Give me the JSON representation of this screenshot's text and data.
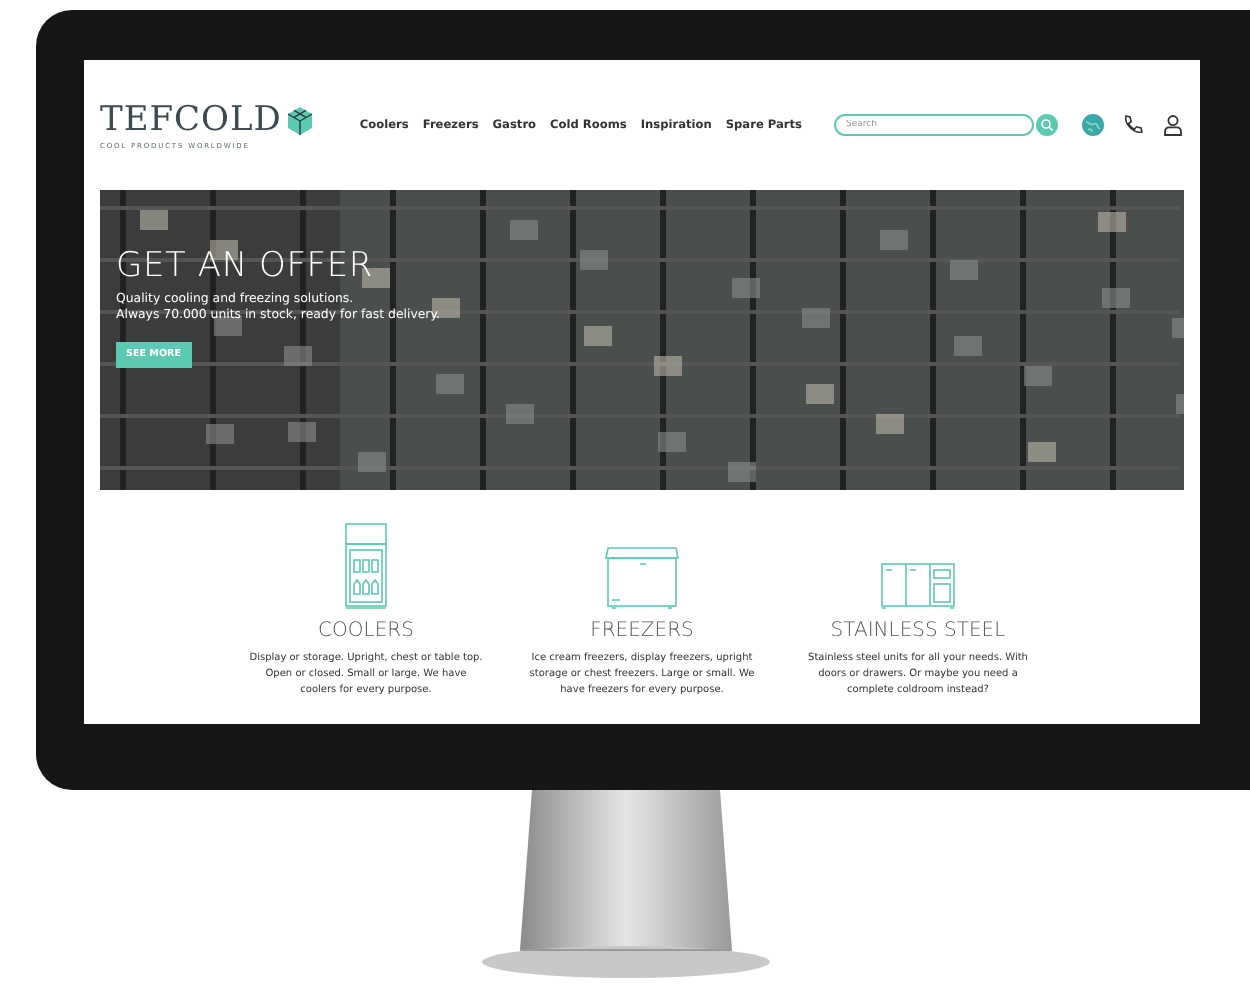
{
  "logo": {
    "name": "TEFCOLD",
    "tagline": "COOL PRODUCTS WORLDWIDE"
  },
  "nav": [
    "Coolers",
    "Freezers",
    "Gastro",
    "Cold Rooms",
    "Inspiration",
    "Spare Parts"
  ],
  "search": {
    "placeholder": "Search"
  },
  "hero": {
    "title": "GET AN OFFER",
    "lines": [
      "Quality cooling and freezing solutions.",
      "Always 70.000 units in stock, ready for fast delivery."
    ],
    "button": "SEE MORE"
  },
  "categories": [
    {
      "kind": "cooler",
      "title": "COOLERS",
      "text": "Display or storage. Upright, chest or table top. Open or closed. Small or large. We have coolers for every purpose."
    },
    {
      "kind": "freezer",
      "title": "FREEZERS",
      "text": "Ice cream freezers, display freezers, upright storage or chest freezers. Large or small. We have freezers for every purpose."
    },
    {
      "kind": "steel",
      "title": "STAINLESS STEEL",
      "text": "Stainless steel units for all your needs. With doors or drawers. Or maybe you need a complete coldroom instead?"
    }
  ]
}
